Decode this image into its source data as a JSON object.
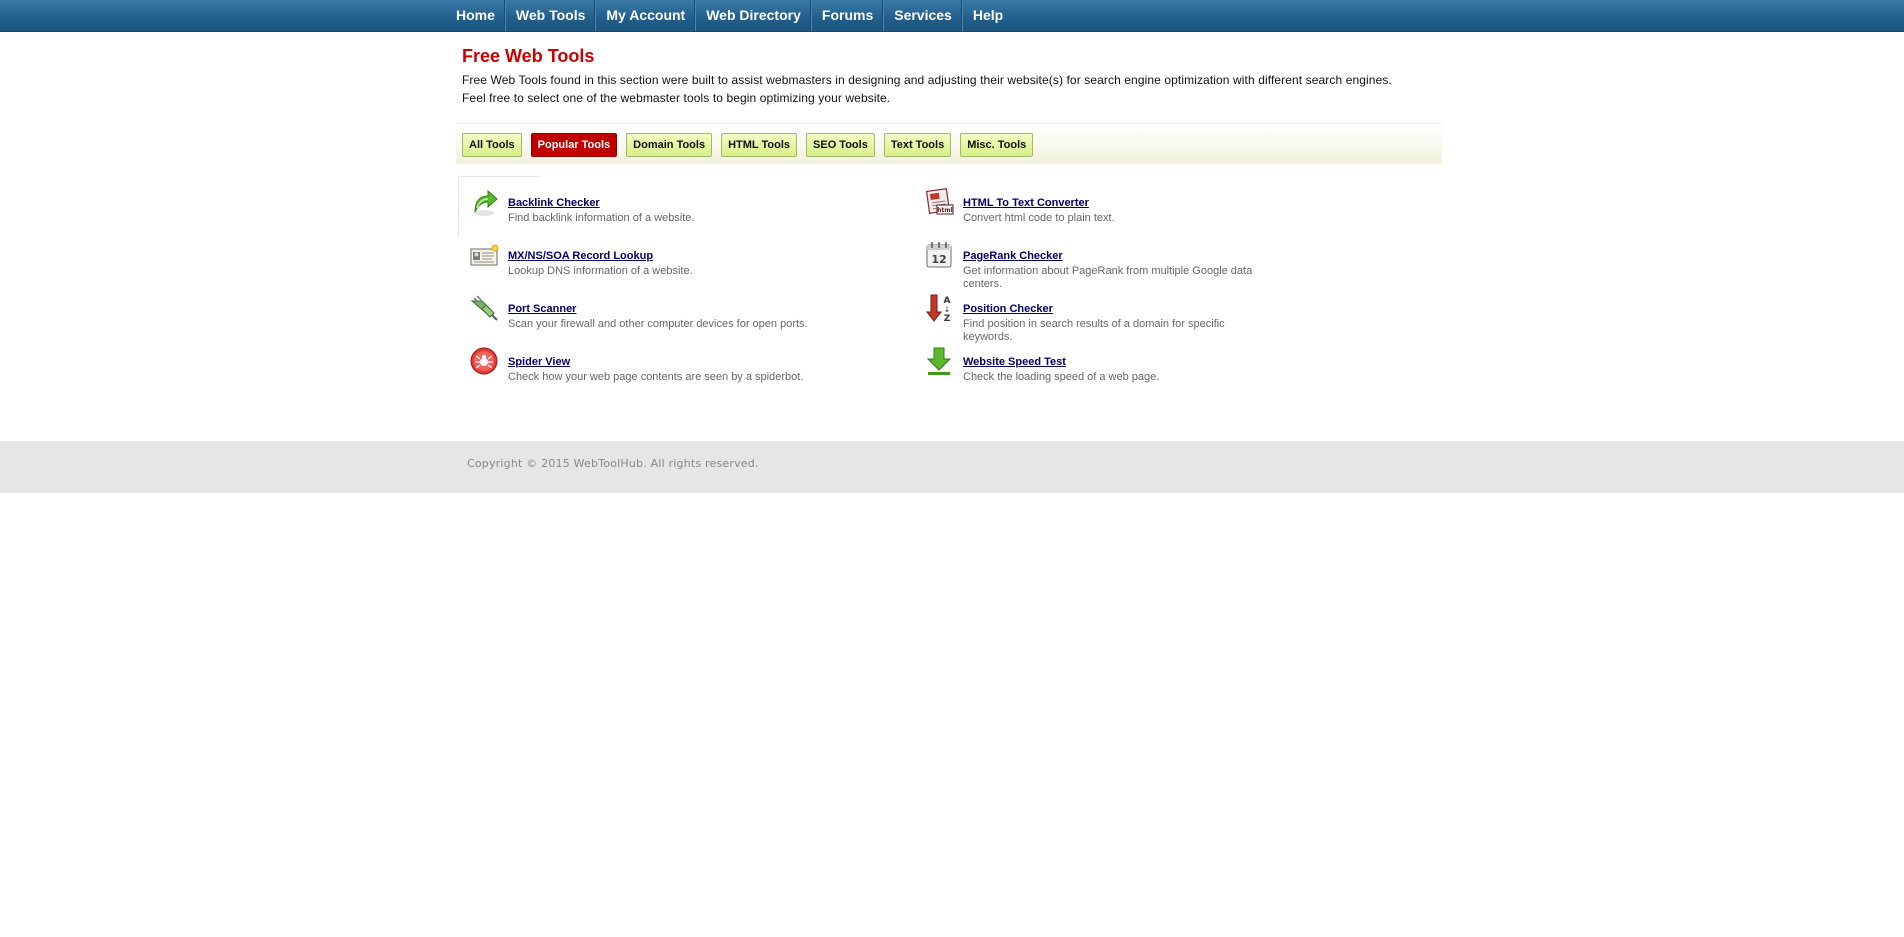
{
  "nav": [
    "Home",
    "Web Tools",
    "My Account",
    "Web Directory",
    "Forums",
    "Services",
    "Help"
  ],
  "page": {
    "title": "Free Web Tools",
    "desc_line1": "Free Web Tools found in this section were built to assist webmasters in designing and adjusting their website(s) for search engine optimization with different search engines.",
    "desc_line2": "Feel free to select one of the webmaster tools to begin optimizing your website."
  },
  "tabs": [
    "All Tools",
    "Popular Tools",
    "Domain Tools",
    "HTML Tools",
    "SEO Tools",
    "Text Tools",
    "Misc. Tools"
  ],
  "active_tab": "Popular Tools",
  "tools": [
    {
      "name": "Backlink Checker",
      "desc": "Find backlink information of a website.",
      "icon": "green-arrow-icon"
    },
    {
      "name": "HTML To Text Converter",
      "desc": "Convert html code to plain text.",
      "icon": "html-document-icon"
    },
    {
      "name": "MX/NS/SOA Record Lookup",
      "desc": "Lookup DNS information of a website.",
      "icon": "id-card-icon"
    },
    {
      "name": "PageRank Checker",
      "desc": "Get information about PageRank from multiple Google data centers.",
      "icon": "calendar-icon"
    },
    {
      "name": "Port Scanner",
      "desc": "Scan your firewall and other computer devices for open ports.",
      "icon": "plug-icon"
    },
    {
      "name": "Position Checker",
      "desc": "Find position in search results of a domain for specific keywords.",
      "icon": "sort-arrow-icon"
    },
    {
      "name": "Spider View",
      "desc": "Check how your web page contents are seen by a spiderbot.",
      "icon": "spider-icon"
    },
    {
      "name": "Website Speed Test",
      "desc": "Check the loading speed of a web page.",
      "icon": "download-arrow-icon"
    }
  ],
  "footer": {
    "copyright": "Copyright © 2015 WebToolHub. All rights reserved."
  },
  "colors": {
    "nav_bg": "#23608e",
    "title": "#cc0000",
    "active_tab": "#c00000",
    "link": "#000066"
  }
}
